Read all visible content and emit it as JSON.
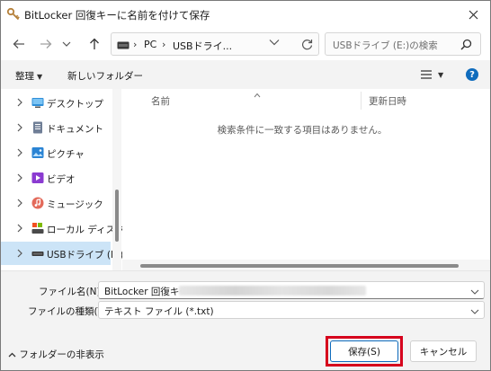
{
  "window": {
    "title": "BitLocker 回復キーに名前を付けて保存",
    "icon": "bitlocker-key-icon"
  },
  "nav": {
    "back_icon": "arrow-left-icon",
    "forward_icon": "arrow-right-icon",
    "forward_dropdown_icon": "chevron-down-icon",
    "up_icon": "arrow-up-icon",
    "address": {
      "drive_icon": "drive-icon",
      "parts": [
        "PC",
        "USBドライ..."
      ]
    },
    "refresh_icon": "refresh-icon",
    "search_placeholder": "USBドライブ (E:)の検索"
  },
  "commands": {
    "organize": "整理",
    "new_folder": "新しいフォルダー",
    "view_icon": "list-view-icon",
    "help_label": "?"
  },
  "sidebar": {
    "items": [
      {
        "label": "デスクトップ",
        "icon": "desktop-icon",
        "color": "#2f8fd8"
      },
      {
        "label": "ドキュメント",
        "icon": "document-icon",
        "color": "#6f7e96"
      },
      {
        "label": "ピクチャ",
        "icon": "pictures-icon",
        "color": "#2a84d4"
      },
      {
        "label": "ビデオ",
        "icon": "videos-icon",
        "color": "#8b3bd1"
      },
      {
        "label": "ミュージック",
        "icon": "music-icon",
        "color": "#d9534f"
      },
      {
        "label": "ローカル ディスク (",
        "icon": "local-disk-icon",
        "color": "#4a7fbf"
      },
      {
        "label": "USBドライブ (E:)",
        "icon": "usb-drive-icon",
        "color": "#555555",
        "selected": true
      }
    ]
  },
  "file_list": {
    "columns": [
      "名前",
      "更新日時"
    ],
    "empty_message": "検索条件に一致する項目はありません。"
  },
  "form": {
    "filename_label": "ファイル名(N):",
    "filename_value": "BitLocker 回復キー",
    "filetype_label": "ファイルの種類(T):",
    "filetype_value": "テキスト ファイル (*.txt)"
  },
  "footer": {
    "hide_folders": "フォルダーの非表示",
    "save": "保存(S)",
    "cancel": "キャンセル"
  },
  "colors": {
    "accent": "#0f6cbd",
    "highlight": "#d6001c",
    "selection": "#cce4f7"
  }
}
